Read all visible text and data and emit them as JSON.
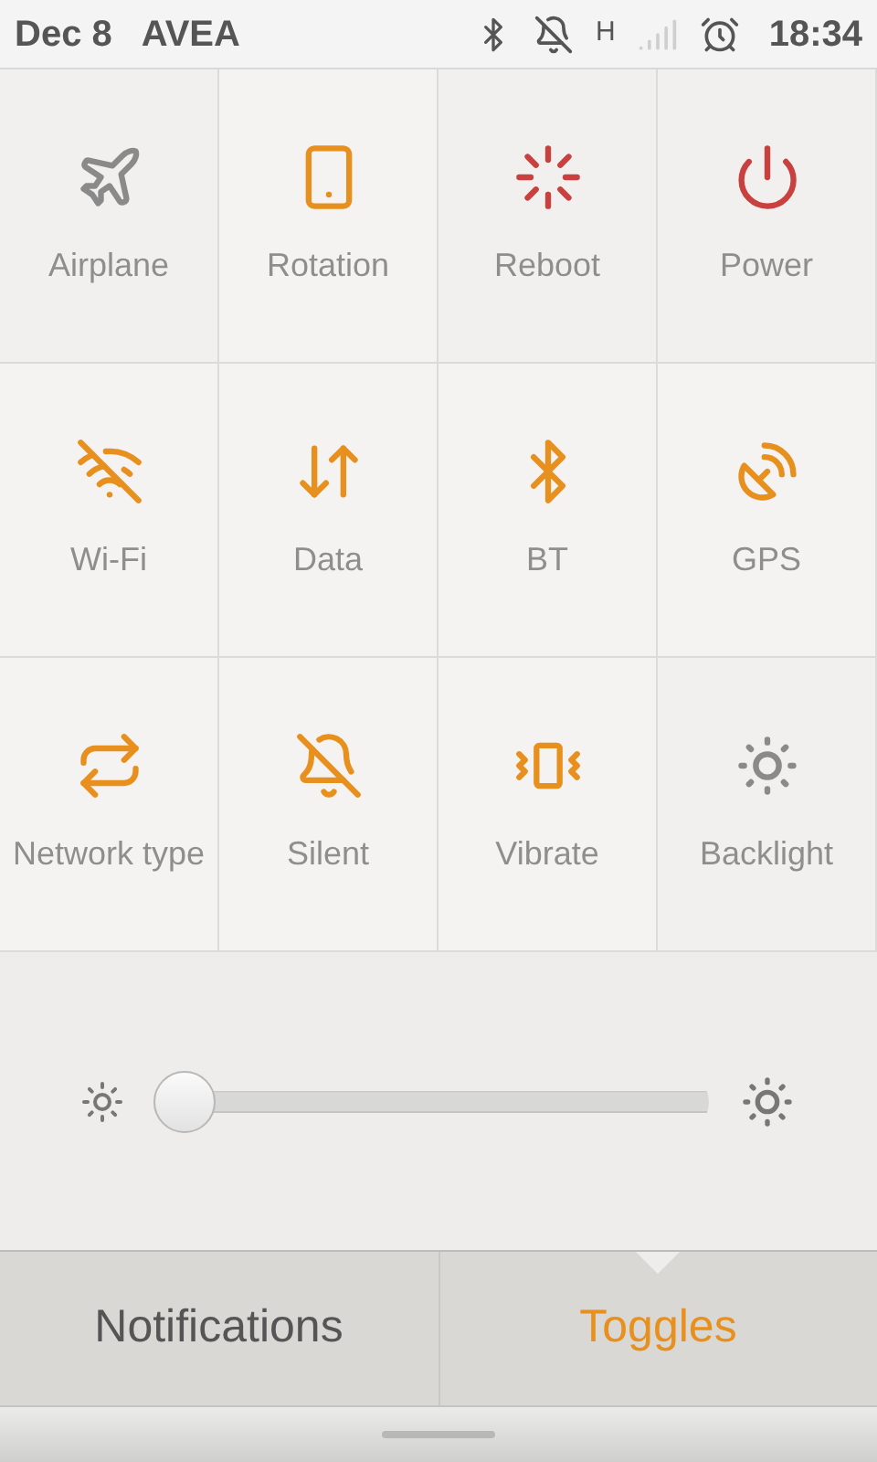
{
  "status_bar": {
    "date": "Dec 8",
    "carrier": "AVEA",
    "network": "H",
    "time": "18:34"
  },
  "toggles": [
    {
      "label": "Airplane",
      "kind": "toggle",
      "on": false
    },
    {
      "label": "Rotation",
      "kind": "toggle",
      "on": true
    },
    {
      "label": "Reboot",
      "kind": "action"
    },
    {
      "label": "Power",
      "kind": "action"
    },
    {
      "label": "Wi-Fi",
      "kind": "toggle",
      "on": true
    },
    {
      "label": "Data",
      "kind": "toggle",
      "on": true
    },
    {
      "label": "BT",
      "kind": "toggle",
      "on": true
    },
    {
      "label": "GPS",
      "kind": "toggle",
      "on": true
    },
    {
      "label": "Network type",
      "kind": "toggle",
      "on": true
    },
    {
      "label": "Silent",
      "kind": "toggle",
      "on": true
    },
    {
      "label": "Vibrate",
      "kind": "toggle",
      "on": true
    },
    {
      "label": "Backlight",
      "kind": "toggle",
      "on": false
    }
  ],
  "brightness": {
    "level": 0.0
  },
  "tabs": [
    {
      "label": "Notifications",
      "selected": false
    },
    {
      "label": "Toggles",
      "selected": true
    }
  ]
}
